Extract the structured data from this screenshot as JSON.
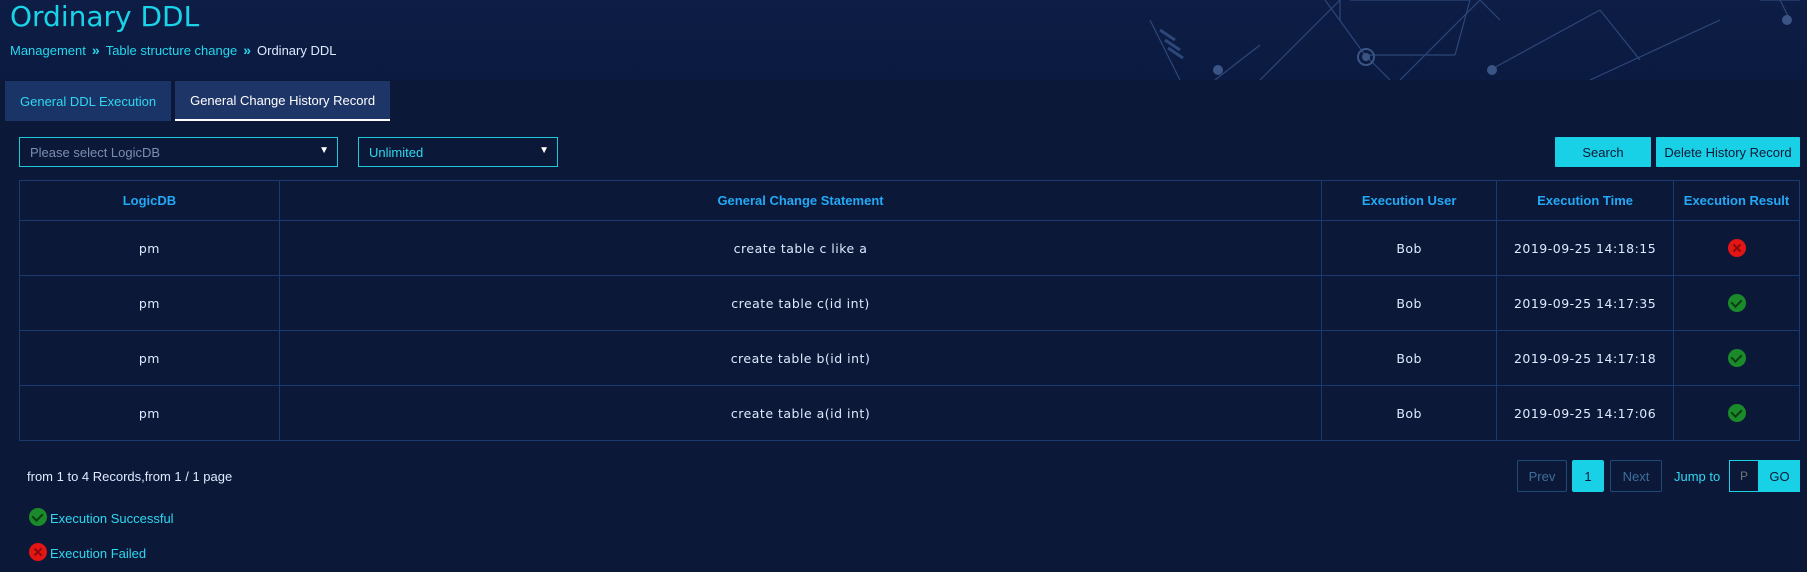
{
  "page": {
    "title": "Ordinary DDL",
    "breadcrumb": [
      "Management",
      "Table structure change",
      "Ordinary DDL"
    ]
  },
  "tabs": [
    {
      "label": "General DDL Execution",
      "active": false
    },
    {
      "label": "General Change History Record",
      "active": true
    }
  ],
  "filters": {
    "logicdb_placeholder": "Please select LogicDB",
    "limit_value": "Unlimited"
  },
  "actions": {
    "search_label": "Search",
    "delete_label": "Delete History Record"
  },
  "table": {
    "columns": [
      "LogicDB",
      "General Change Statement",
      "Execution User",
      "Execution Time",
      "Execution Result"
    ],
    "rows": [
      {
        "logicdb": "pm",
        "statement": "create table c like a",
        "user": "Bob",
        "time": "2019-09-25 14:18:15",
        "result": "fail"
      },
      {
        "logicdb": "pm",
        "statement": "create table c(id int)",
        "user": "Bob",
        "time": "2019-09-25 14:17:35",
        "result": "success"
      },
      {
        "logicdb": "pm",
        "statement": "create table b(id int)",
        "user": "Bob",
        "time": "2019-09-25 14:17:18",
        "result": "success"
      },
      {
        "logicdb": "pm",
        "statement": "create table a(id int)",
        "user": "Bob",
        "time": "2019-09-25 14:17:06",
        "result": "success"
      }
    ]
  },
  "pagination": {
    "summary": "from 1 to 4 Records,from 1 / 1 page",
    "prev_label": "Prev",
    "current_page": "1",
    "next_label": "Next",
    "jump_label": "Jump to",
    "jump_placeholder": "P",
    "go_label": "GO"
  },
  "legend": {
    "success_label": "Execution Successful",
    "fail_label": "Execution Failed"
  },
  "colors": {
    "background": "#0b1838",
    "accent": "#19d1e6",
    "header_text": "#23a9f5",
    "success": "#1a8a2a",
    "fail": "#e41515"
  }
}
